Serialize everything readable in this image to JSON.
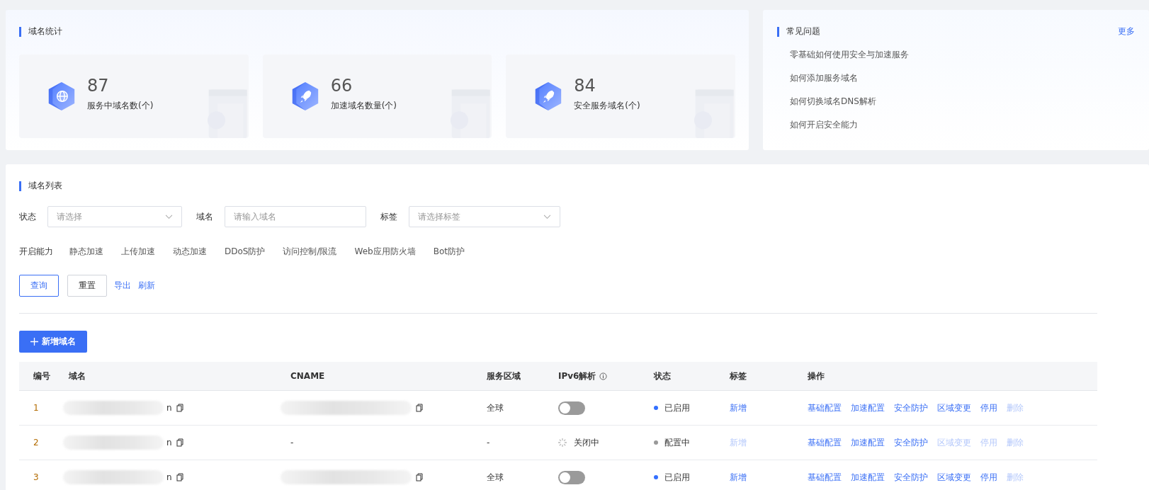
{
  "stats": {
    "title": "域名统计",
    "cards": [
      {
        "kind": "globe",
        "value": "87",
        "label": "服务中域名数(个)"
      },
      {
        "kind": "rocket",
        "value": "66",
        "label": "加速域名数量(个)"
      },
      {
        "kind": "rocket",
        "value": "84",
        "label": "安全服务域名(个)"
      }
    ]
  },
  "faq": {
    "title": "常见问题",
    "more": "更多",
    "items": [
      "零基础如何使用安全与加速服务",
      "如何添加服务域名",
      "如何切换域名DNS解析",
      "如何开启安全能力"
    ]
  },
  "domain_list": {
    "title": "域名列表",
    "filters": [
      {
        "kind": "select",
        "label": "状态",
        "placeholder": "请选择"
      },
      {
        "kind": "input",
        "label": "域名",
        "placeholder": "请输入域名"
      },
      {
        "kind": "select",
        "label": "标签",
        "placeholder": "请选择标签"
      }
    ],
    "capabilities": {
      "label": "开启能力",
      "options": [
        "静态加速",
        "上传加速",
        "动态加速",
        "DDoS防护",
        "访问控制/限流",
        "Web应用防火墙",
        "Bot防护"
      ]
    },
    "query_button": "查询",
    "reset_button": "重置",
    "links": [
      "导出",
      "刷新"
    ],
    "add_button": "新增域名",
    "table": {
      "columns": [
        "编号",
        "域名",
        "CNAME",
        "服务区域",
        "IPv6解析",
        "状态",
        "标签",
        "操作"
      ],
      "rows": [
        {
          "index": "1",
          "domain_redacted": true,
          "domain": "n",
          "cname_redacted": true,
          "region": "全球",
          "ipv6": {
            "kind": "switch",
            "on": false
          },
          "status": {
            "text": "已启用",
            "color": "#3370ff"
          },
          "tag": {
            "text": "新增",
            "disabled": false
          },
          "actions": [
            {
              "text": "基础配置",
              "disabled": false
            },
            {
              "text": "加速配置",
              "disabled": false
            },
            {
              "text": "安全防护",
              "disabled": false
            },
            {
              "text": "区域变更",
              "disabled": false
            },
            {
              "text": "停用",
              "disabled": false
            },
            {
              "text": "删除",
              "disabled": true
            }
          ]
        },
        {
          "index": "2",
          "domain_redacted": true,
          "domain": "n",
          "cname_redacted": false,
          "cname": "-",
          "region": "-",
          "ipv6": {
            "kind": "pending",
            "text": "关闭中"
          },
          "status": {
            "text": "配置中",
            "color": "#999999"
          },
          "tag": {
            "text": "新增",
            "disabled": true
          },
          "actions": [
            {
              "text": "基础配置",
              "disabled": false
            },
            {
              "text": "加速配置",
              "disabled": false
            },
            {
              "text": "安全防护",
              "disabled": false
            },
            {
              "text": "区域变更",
              "disabled": true
            },
            {
              "text": "停用",
              "disabled": true
            },
            {
              "text": "删除",
              "disabled": true
            }
          ]
        },
        {
          "index": "3",
          "domain_redacted": true,
          "domain": "n",
          "cname_redacted": true,
          "region": "全球",
          "ipv6": {
            "kind": "switch",
            "on": false
          },
          "status": {
            "text": "已启用",
            "color": "#3370ff"
          },
          "tag": {
            "text": "新增",
            "disabled": false
          },
          "actions": [
            {
              "text": "基础配置",
              "disabled": false
            },
            {
              "text": "加速配置",
              "disabled": false
            },
            {
              "text": "安全防护",
              "disabled": false
            },
            {
              "text": "区域变更",
              "disabled": false
            },
            {
              "text": "停用",
              "disabled": false
            },
            {
              "text": "删除",
              "disabled": true
            }
          ]
        }
      ]
    }
  }
}
